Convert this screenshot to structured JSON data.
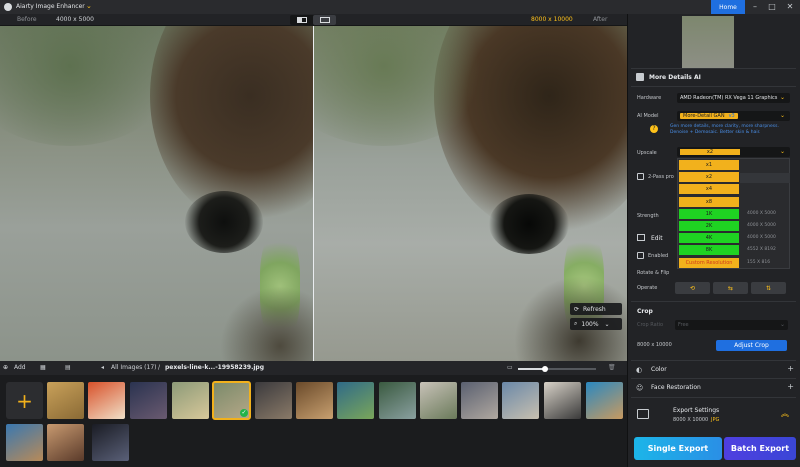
{
  "app": {
    "title": "Aiarty Image Enhancer",
    "home_label": "Home",
    "window_controls": [
      "–",
      "□",
      "✕"
    ]
  },
  "compare": {
    "before_label": "Before",
    "before_res": "4000 x 5000",
    "after_res": "8000 x 10000",
    "after_label": "After"
  },
  "preview": {
    "refresh_label": "Refresh",
    "zoom_value": "100%"
  },
  "bottombar": {
    "add_label": "Add",
    "all_images": "All Images (17)",
    "separator": "/",
    "filename": "pexels-line-k...-19958239.jpg",
    "zoom_fraction": 0.35
  },
  "thumbnails": [
    {
      "c1": "#c9a15a",
      "c2": "#8a6a35"
    },
    {
      "c1": "#d8512a",
      "c2": "#f0e0c8"
    },
    {
      "c1": "#2a3350",
      "c2": "#6a5a70"
    },
    {
      "c1": "#8c9a78",
      "c2": "#d8c89a"
    },
    {
      "c1": "#7a8a6a",
      "c2": "#b6a888",
      "selected": true
    },
    {
      "c1": "#3b3a3d",
      "c2": "#8a7a68"
    },
    {
      "c1": "#6a4a2a",
      "c2": "#c8a070"
    },
    {
      "c1": "#2f6a88",
      "c2": "#7aa65a"
    },
    {
      "c1": "#3a5a40",
      "c2": "#8aa0a0"
    },
    {
      "c1": "#c8c2b8",
      "c2": "#6a7a5a"
    },
    {
      "c1": "#5a6070",
      "c2": "#b0a8a0"
    },
    {
      "c1": "#6a88a8",
      "c2": "#c8c0b0"
    },
    {
      "c1": "#d8d2c8",
      "c2": "#3a3a3a"
    },
    {
      "c1": "#2a88c0",
      "c2": "#c89a60"
    },
    {
      "c1": "#3a78b0",
      "c2": "#b88a58"
    },
    {
      "c1": "#c89a70",
      "c2": "#5a3a2a"
    },
    {
      "c1": "#1a1c24",
      "c2": "#5a6078"
    }
  ],
  "panel": {
    "section_title": "More Details AI",
    "hardware_label": "Hardware",
    "hardware_value": "AMD Radeon(TM) RX Vega 11 Graphics",
    "ai_model_label": "AI Model",
    "ai_model_value": "More-Detail GAN",
    "ai_model_version": "v3",
    "ai_model_desc": "Gen more details, more clarity, more sharpness. Denoise + Demosaic. Better skin & hair.",
    "upscale_label": "Upscale",
    "upscale_value": "x2",
    "two_pass_label": "2-Pass pro",
    "strength_label": "Strength",
    "edit_label": "Edit",
    "enabled_label": "Enabled",
    "rotate_label": "Rotate & Flip",
    "operate_label": "Operate",
    "operate_icons": [
      "⟲",
      "⇆",
      "⇅"
    ],
    "crop_label": "Crop",
    "crop_ratio_label": "Crop Ratio",
    "crop_ratio_value": "Free",
    "crop_res": "8000 x 10000",
    "adjust_crop": "Adjust Crop",
    "color_label": "Color",
    "face_label": "Face Restoration",
    "export_settings": "Export Settings",
    "export_res": "8000 X 10000",
    "export_fmt": "JPG",
    "single_export": "Single Export",
    "batch_export": "Batch Export"
  },
  "upscale_options": [
    {
      "label": "x1",
      "res": "",
      "color": "#f2b11c",
      "text": "#1b1c1e"
    },
    {
      "label": "x2",
      "res": "",
      "color": "#f2b11c",
      "text": "#1b1c1e"
    },
    {
      "label": "x4",
      "res": "",
      "color": "#f2b11c",
      "text": "#1b1c1e"
    },
    {
      "label": "x8",
      "res": "",
      "color": "#f2b11c",
      "text": "#1b1c1e"
    },
    {
      "label": "1K",
      "res": "4000 X 5000",
      "color": "#1fd322",
      "text": "#1b1c1e"
    },
    {
      "label": "2K",
      "res": "4000 X 5000",
      "color": "#1fd322",
      "text": "#1b1c1e"
    },
    {
      "label": "4K",
      "res": "4000 X 5000",
      "color": "#1fd322",
      "text": "#1b1c1e"
    },
    {
      "label": "8K",
      "res": "4552 X 8192",
      "color": "#1fd322",
      "text": "#1b1c1e"
    },
    {
      "label": "Custom Resolution",
      "res": "155 X 816",
      "color": "#f2b11c",
      "text": "#d23a1a"
    }
  ],
  "colors": {
    "accent": "#f2b11c",
    "blue": "#1f6fe0",
    "green": "#1fd322"
  }
}
